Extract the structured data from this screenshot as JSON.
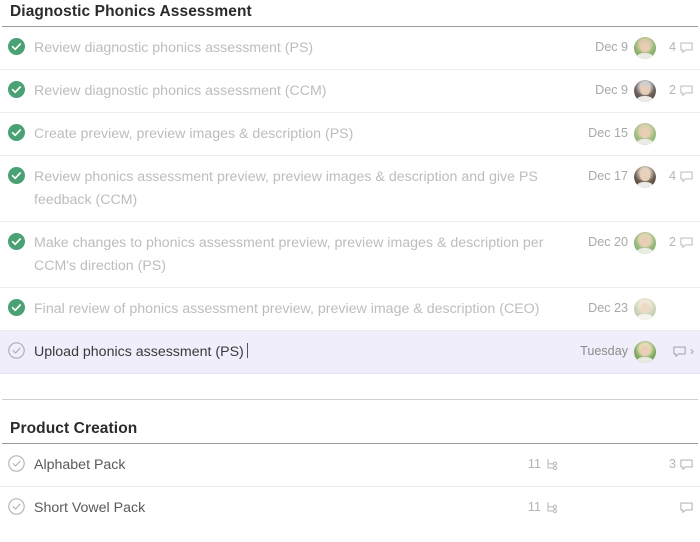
{
  "colors": {
    "done_green": "#4aa173",
    "pending_gray": "#b0b0b0",
    "selected_row_bg": "#f0eefb",
    "muted_text": "#bdbdbd",
    "header_text": "#2b2b2b"
  },
  "sections": [
    {
      "title": "Diagnostic Phonics Assessment",
      "tasks": [
        {
          "title": "Review diagnostic phonics assessment (PS)",
          "status": "done",
          "status_icon": "check-circle-filled-icon",
          "date": "Dec 9",
          "avatar": "assignee-avatar",
          "avatar_tone": "green",
          "comment_count": "4",
          "comment_icon": "comment-bubble-icon",
          "selected": false,
          "chevron": "",
          "subtask_count": ""
        },
        {
          "title": "Review diagnostic phonics assessment (CCM)",
          "status": "done",
          "status_icon": "check-circle-filled-icon",
          "date": "Dec 9",
          "avatar": "assignee-avatar",
          "avatar_tone": "light",
          "comment_count": "2",
          "comment_icon": "comment-bubble-icon",
          "selected": false,
          "chevron": "",
          "subtask_count": ""
        },
        {
          "title": "Create preview, preview images & description (PS)",
          "status": "done",
          "status_icon": "check-circle-filled-icon",
          "date": "Dec 15",
          "avatar": "assignee-avatar",
          "avatar_tone": "green",
          "comment_count": "",
          "comment_icon": "",
          "selected": false,
          "chevron": "",
          "subtask_count": ""
        },
        {
          "title": "Review phonics assessment preview, preview images & description and give PS feedback (CCM)",
          "status": "done",
          "status_icon": "check-circle-filled-icon",
          "date": "Dec 17",
          "avatar": "assignee-avatar",
          "avatar_tone": "light",
          "comment_count": "4",
          "comment_icon": "comment-bubble-icon",
          "selected": false,
          "chevron": "",
          "subtask_count": ""
        },
        {
          "title": "Make changes to phonics assessment preview, preview images & description per CCM's direction (PS)",
          "status": "done",
          "status_icon": "check-circle-filled-icon",
          "date": "Dec 20",
          "avatar": "assignee-avatar",
          "avatar_tone": "green",
          "comment_count": "2",
          "comment_icon": "comment-bubble-icon",
          "selected": false,
          "chevron": "",
          "subtask_count": ""
        },
        {
          "title": "Final review of phonics assessment preview, preview image & description (CEO)",
          "status": "done",
          "status_icon": "check-circle-filled-icon",
          "date": "Dec 23",
          "avatar": "assignee-avatar",
          "avatar_tone": "pale",
          "comment_count": "",
          "comment_icon": "",
          "selected": false,
          "chevron": "",
          "subtask_count": ""
        },
        {
          "title": "Upload phonics assessment (PS)",
          "status": "open",
          "status_icon": "check-circle-outline-icon",
          "date": "Tuesday",
          "avatar": "assignee-avatar",
          "avatar_tone": "green",
          "comment_count": "",
          "comment_icon": "comment-bubble-icon",
          "selected": true,
          "chevron": "›",
          "subtask_count": ""
        }
      ]
    },
    {
      "title": "Product Creation",
      "tasks": [
        {
          "title": "Alphabet Pack",
          "status": "open",
          "status_icon": "check-circle-outline-icon",
          "date": "",
          "avatar": "",
          "avatar_tone": "",
          "comment_count": "3",
          "comment_icon": "comment-bubble-icon",
          "selected": false,
          "chevron": "",
          "subtask_count": "11",
          "subtask_icon": "subtask-branch-icon"
        },
        {
          "title": "Short Vowel Pack",
          "status": "open",
          "status_icon": "check-circle-outline-icon",
          "date": "",
          "avatar": "",
          "avatar_tone": "",
          "comment_count": "",
          "comment_icon": "comment-bubble-icon",
          "selected": false,
          "chevron": "",
          "subtask_count": "11",
          "subtask_icon": "subtask-branch-icon"
        }
      ]
    }
  ]
}
